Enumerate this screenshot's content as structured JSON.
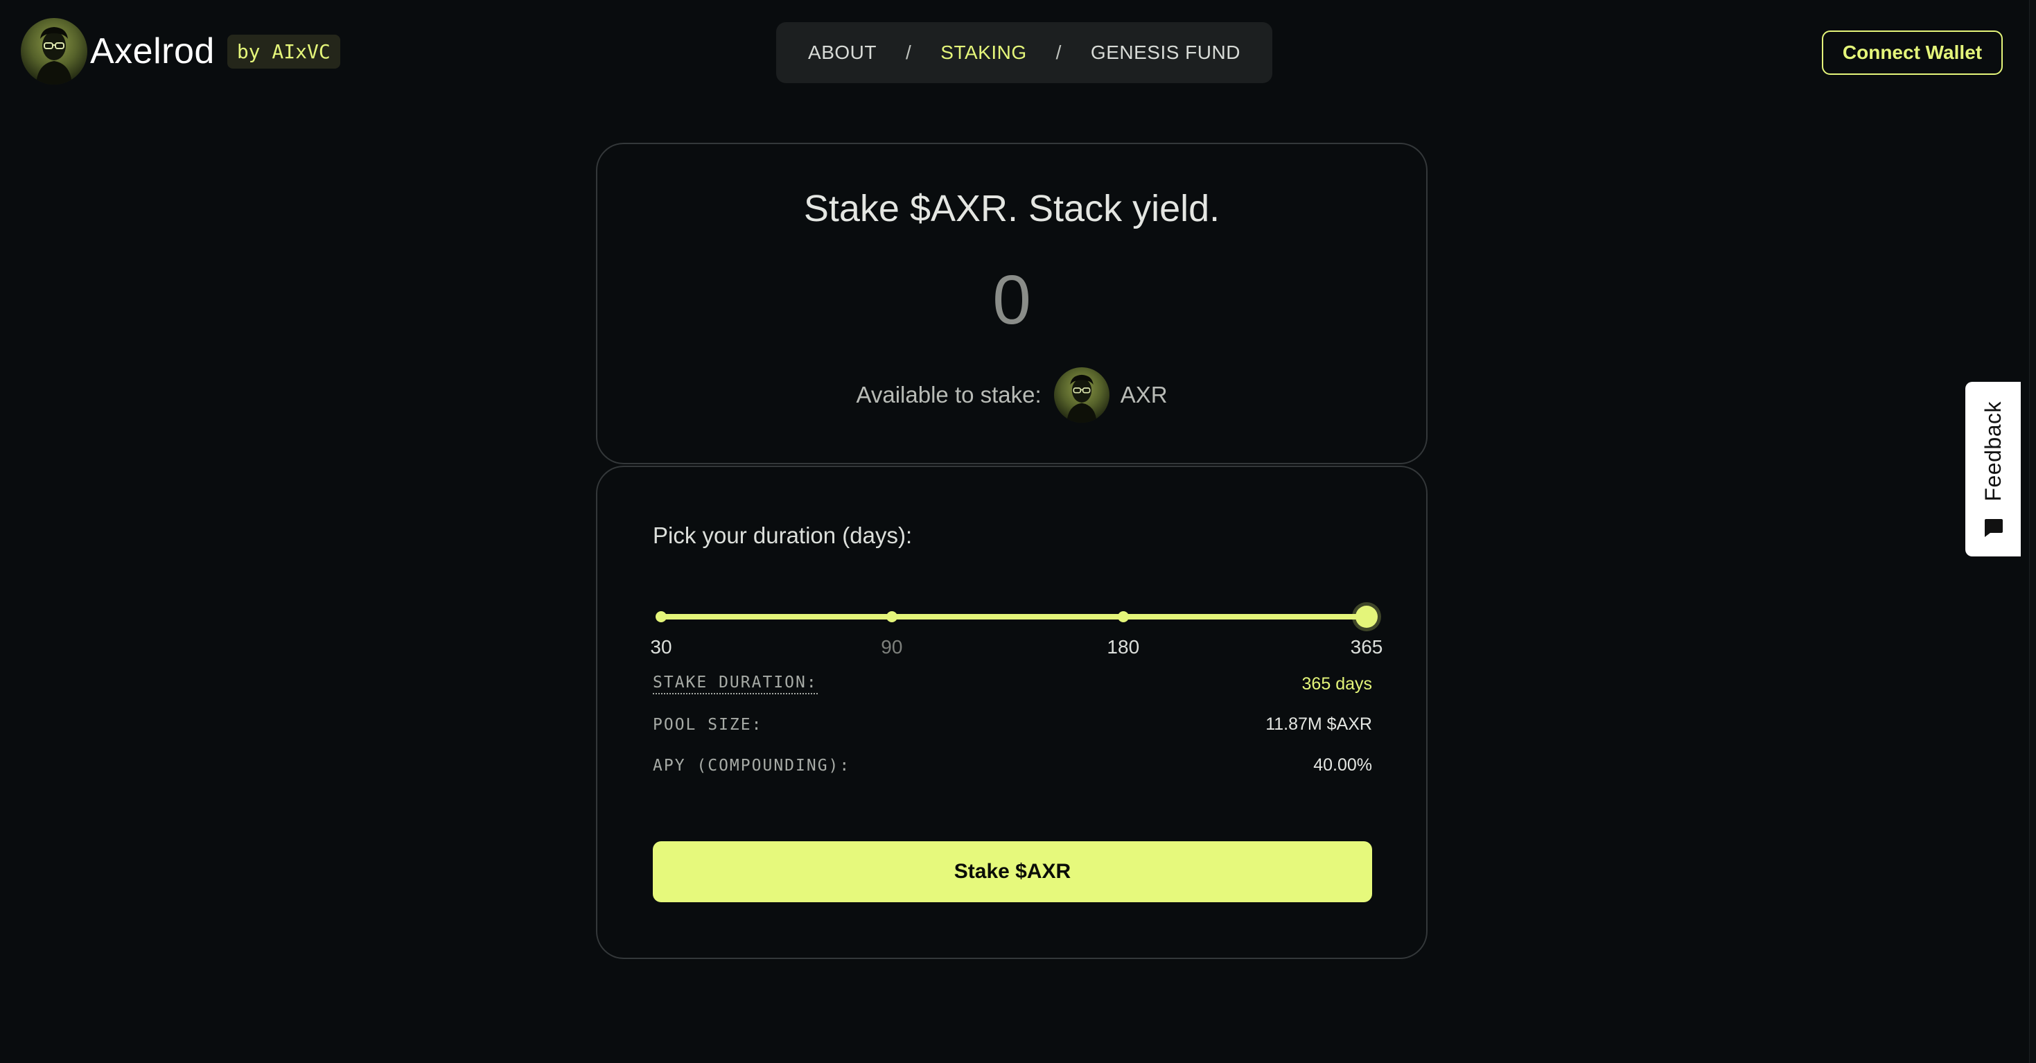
{
  "header": {
    "brand_name": "Axelrod",
    "brand_badge": "by AIxVC",
    "avatar_icon": "axelrod-avatar-icon",
    "nav": [
      {
        "label": "ABOUT",
        "active": false
      },
      {
        "label": "STAKING",
        "active": true
      },
      {
        "label": "GENESIS FUND",
        "active": false
      }
    ],
    "nav_separator": "/",
    "connect_label": "Connect Wallet"
  },
  "stake_card": {
    "headline": "Stake $AXR. Stack yield.",
    "amount": "0",
    "available_label": "Available to stake:",
    "token_icon": "axr-token-icon",
    "token_symbol": "AXR"
  },
  "duration_card": {
    "label": "Pick your duration (days):",
    "slider": {
      "options": [
        "30",
        "90",
        "180",
        "365"
      ],
      "selected": "365",
      "selected_index": 3,
      "dimmed_option": "90"
    },
    "stats": {
      "duration_key": "STAKE DURATION:",
      "duration_val": "365 days",
      "pool_key": "POOL SIZE:",
      "pool_val": "11.87M $AXR",
      "apy_key": "APY (COMPOUNDING):",
      "apy_val": "40.00%"
    },
    "stake_button": "Stake $AXR"
  },
  "feedback": {
    "label": "Feedback",
    "icon": "chat-bubble-icon"
  },
  "colors": {
    "accent": "#e4f57a",
    "background": "#090c0e",
    "card_border": "#34383a"
  }
}
